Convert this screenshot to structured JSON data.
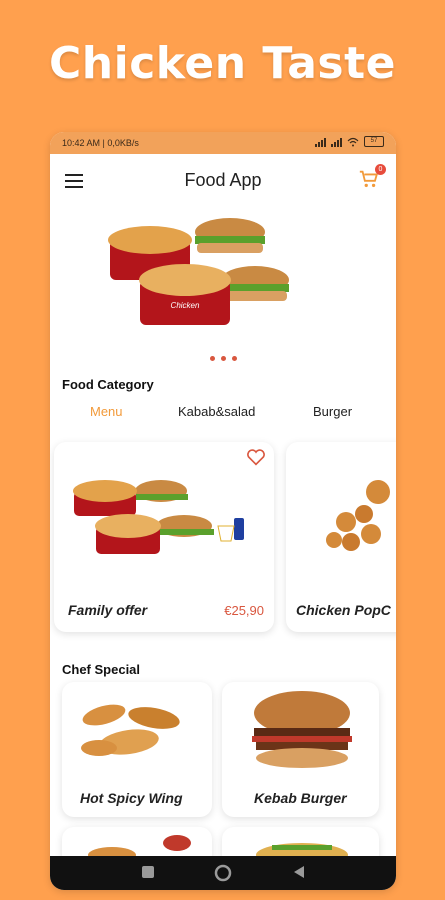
{
  "promo": {
    "title": "Chicken Taste"
  },
  "status_bar": {
    "text": "10:42 AM | 0,0KB/s",
    "battery": "57"
  },
  "app_bar": {
    "title": "Food App",
    "cart_count": "0"
  },
  "category": {
    "title": "Food Category",
    "tabs": [
      {
        "label": "Menu",
        "active": true
      },
      {
        "label": "Kabab&salad"
      },
      {
        "label": "Burger"
      }
    ]
  },
  "featured": [
    {
      "name": "Family offer",
      "price": "€25,90",
      "favorite_icon": "heart-icon"
    },
    {
      "name": "Chicken PopC"
    }
  ],
  "chef_special": {
    "title": "Chef Special",
    "items": [
      {
        "name": "Hot Spicy Wing"
      },
      {
        "name": "Kebab Burger"
      }
    ]
  },
  "colors": {
    "background": "#FFA04E",
    "accent": "#F29A3A",
    "price": "#d9573f"
  }
}
